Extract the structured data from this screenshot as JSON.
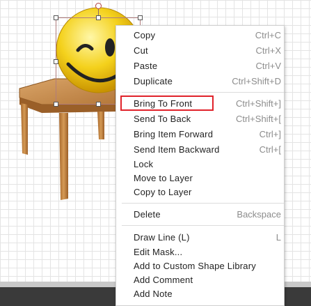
{
  "menu": {
    "copy": {
      "label": "Copy",
      "shortcut": "Ctrl+C"
    },
    "cut": {
      "label": "Cut",
      "shortcut": "Ctrl+X"
    },
    "paste": {
      "label": "Paste",
      "shortcut": "Ctrl+V"
    },
    "duplicate": {
      "label": "Duplicate",
      "shortcut": "Ctrl+Shift+D"
    },
    "bring_to_front": {
      "label": "Bring To Front",
      "shortcut": "Ctrl+Shift+]"
    },
    "send_to_back": {
      "label": "Send To Back",
      "shortcut": "Ctrl+Shift+["
    },
    "bring_item_forward": {
      "label": "Bring Item Forward",
      "shortcut": "Ctrl+]"
    },
    "send_item_backward": {
      "label": "Send Item Backward",
      "shortcut": "Ctrl+["
    },
    "lock": {
      "label": "Lock"
    },
    "move_to_layer": {
      "label": "Move to Layer"
    },
    "copy_to_layer": {
      "label": "Copy to Layer"
    },
    "delete": {
      "label": "Delete",
      "shortcut": "Backspace"
    },
    "draw_line": {
      "label": "Draw Line (L)",
      "shortcut": "L"
    },
    "edit_mask": {
      "label": "Edit Mask..."
    },
    "add_custom_shape": {
      "label": "Add to Custom Shape Library"
    },
    "add_comment": {
      "label": "Add Comment"
    },
    "add_note": {
      "label": "Add Note"
    }
  },
  "colors": {
    "highlight": "#e0222a",
    "selection_border": "#b07c7c",
    "smiley_yellow": "#f4d11c",
    "table_wood": "#c98a45"
  },
  "icons": [
    "smiley-face-icon",
    "wooden-table-image"
  ]
}
